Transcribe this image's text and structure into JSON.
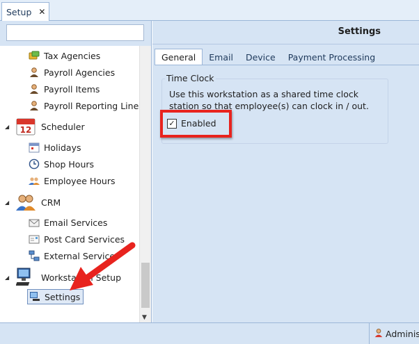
{
  "document_tab": {
    "label": "Setup",
    "close": "✕"
  },
  "search": {
    "placeholder": "",
    "value": ""
  },
  "nav": {
    "items": [
      {
        "label": "Tax Agencies",
        "icon": "tax-agency-icon"
      },
      {
        "label": "Payroll Agencies",
        "icon": "person-icon"
      },
      {
        "label": "Payroll Items",
        "icon": "person-icon"
      },
      {
        "label": "Payroll Reporting Lines",
        "icon": "person-icon"
      },
      {
        "label": "Scheduler",
        "icon": "calendar-icon",
        "badge": "12"
      },
      {
        "label": "Holidays",
        "icon": "calendar-small-icon"
      },
      {
        "label": "Shop Hours",
        "icon": "clock-icon"
      },
      {
        "label": "Employee Hours",
        "icon": "people-icon"
      },
      {
        "label": "CRM",
        "icon": "crm-people-icon"
      },
      {
        "label": "Email Services",
        "icon": "envelope-icon"
      },
      {
        "label": "Post Card Services",
        "icon": "postcard-icon"
      },
      {
        "label": "External Services",
        "icon": "network-icon"
      },
      {
        "label": "Workstation Setup",
        "icon": "computer-icon"
      },
      {
        "label": "Settings",
        "icon": "computer-small-icon"
      }
    ]
  },
  "settings": {
    "title": "Settings",
    "tabs": [
      "General",
      "Email",
      "Device",
      "Payment Processing"
    ],
    "active_tab": "General",
    "time_clock": {
      "title": "Time Clock",
      "description": "Use this workstation as a shared time clock station so that employee(s) can clock in / out.",
      "enabled_label": "Enabled",
      "enabled": true,
      "check_mark": "✓"
    }
  },
  "status": {
    "user": "Administrator"
  },
  "colors": {
    "accent": "#1e395b",
    "highlight": "#e8231e",
    "panel": "#d6e4f4"
  }
}
